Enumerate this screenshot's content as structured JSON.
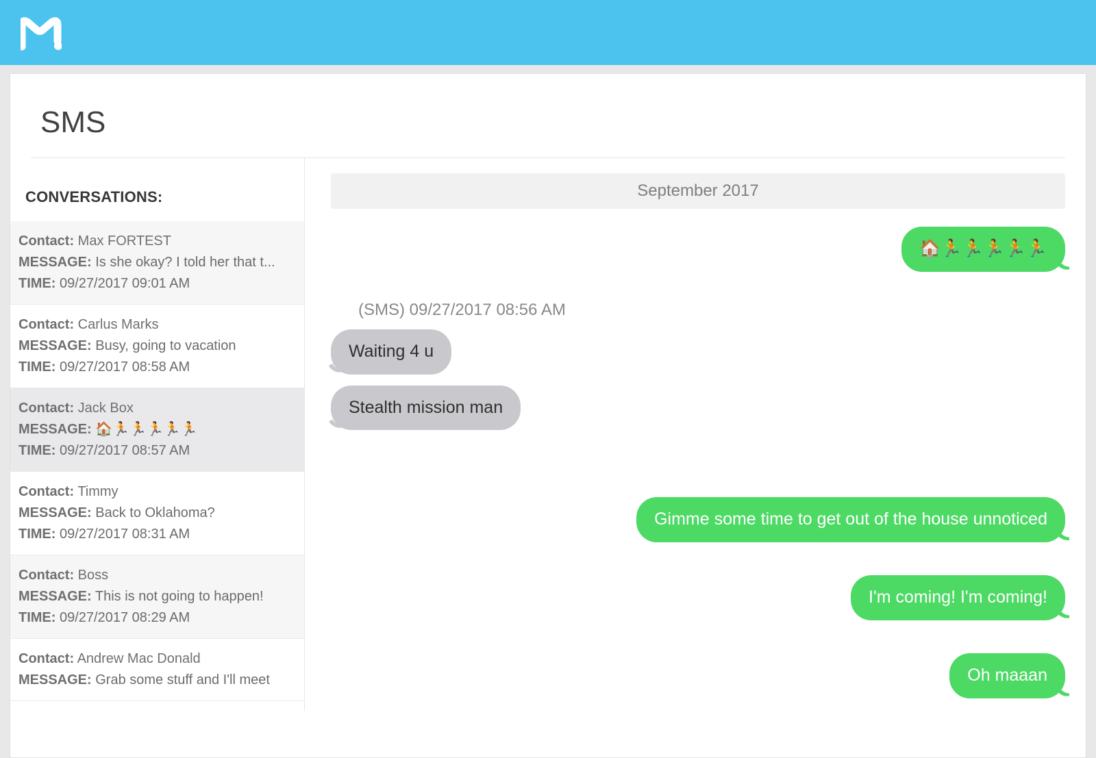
{
  "header": {
    "brand": "mSpy"
  },
  "page": {
    "title": "SMS"
  },
  "sidebar": {
    "heading": "CONVERSATIONS:",
    "labels": {
      "contact": "Contact:",
      "message": "MESSAGE:",
      "time": "TIME:"
    },
    "items": [
      {
        "contact": "Max FORTEST",
        "message": "Is she okay? I told her that t...",
        "time": "09/27/2017 09:01 AM",
        "selected": false,
        "alt": true
      },
      {
        "contact": "Carlus Marks",
        "message": "Busy, going to vacation",
        "time": "09/27/2017 08:58 AM",
        "selected": false,
        "alt": false
      },
      {
        "contact": "Jack Box",
        "message": "🏠🏃🏃🏃🏃🏃",
        "time": "09/27/2017 08:57 AM",
        "selected": true,
        "alt": false
      },
      {
        "contact": "Timmy",
        "message": "Back to Oklahoma?",
        "time": "09/27/2017 08:31 AM",
        "selected": false,
        "alt": false
      },
      {
        "contact": "Boss",
        "message": "This is not going to happen!",
        "time": "09/27/2017 08:29 AM",
        "selected": false,
        "alt": true
      },
      {
        "contact": "Andrew Mac Donald",
        "message": "Grab some stuff and I'll meet",
        "time": "",
        "selected": false,
        "alt": false
      }
    ]
  },
  "chat": {
    "date_banner": "September 2017",
    "incoming_meta": "(SMS) 09/27/2017 08:56 AM",
    "messages": [
      {
        "side": "right",
        "text": "🏠🏃🏃🏃🏃🏃"
      },
      {
        "side": "left",
        "text": "Waiting 4 u"
      },
      {
        "side": "left",
        "text": "Stealth mission man"
      },
      {
        "side": "right",
        "text": "Gimme some time to get out of the house unnoticed"
      },
      {
        "side": "right",
        "text": "I'm coming! I'm coming!"
      },
      {
        "side": "right",
        "text": "Oh maaan"
      }
    ]
  }
}
